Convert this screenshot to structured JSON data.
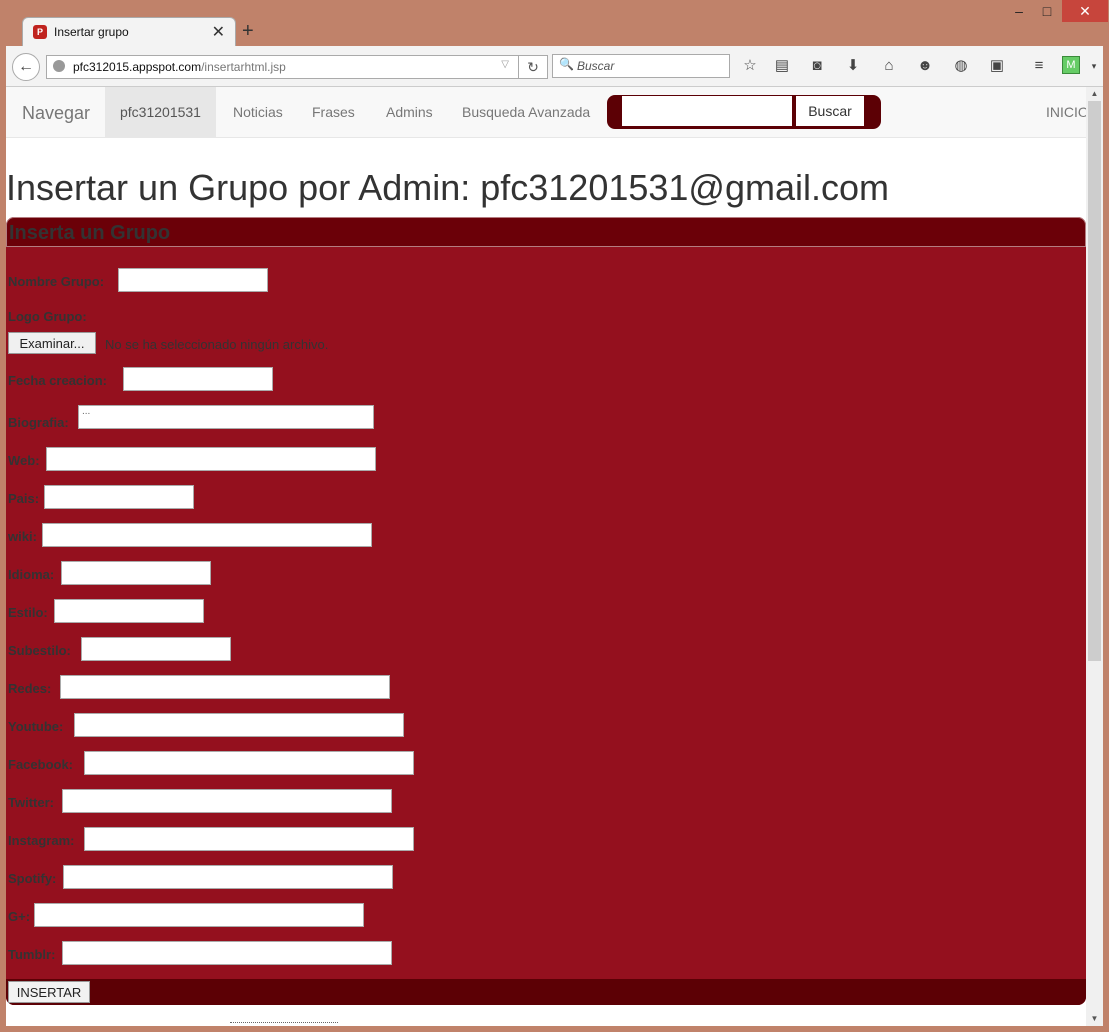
{
  "browser": {
    "tab_title": "Insertar grupo",
    "favicon_text": "P",
    "url_host": "pfc312015.appspot.com",
    "url_path": "/insertarhtml.jsp",
    "search_placeholder": "Buscar"
  },
  "navbar": {
    "brand": "Navegar",
    "items": [
      "pfc31201531",
      "Noticias",
      "Frases",
      "Admins",
      "Busqueda Avanzada"
    ],
    "search_button": "Buscar",
    "right_link": "INICIO"
  },
  "page": {
    "title": "Insertar un Grupo por Admin: pfc31201531@gmail.com",
    "panel_title": "Inserta un Grupo",
    "logo_label": "Logo Grupo:",
    "file_button": "Examinar...",
    "file_status": "No se ha seleccionado ningún archivo.",
    "textarea_placeholder": "...",
    "submit": "INSERTAR",
    "fields": [
      {
        "label": "Nombre Grupo:"
      },
      {
        "label": "Fecha creacion:"
      },
      {
        "label": "Biografia:"
      },
      {
        "label": "Web:"
      },
      {
        "label": "Pais:"
      },
      {
        "label": "wiki:"
      },
      {
        "label": "Idioma:"
      },
      {
        "label": "Estilo:"
      },
      {
        "label": "Subestilo:"
      },
      {
        "label": "Redes:"
      },
      {
        "label": "Youtube:"
      },
      {
        "label": "Facebook:"
      },
      {
        "label": "Twitter:"
      },
      {
        "label": "Instagram:"
      },
      {
        "label": "Spotify:"
      },
      {
        "label": "G+:"
      },
      {
        "label": "Tumblr:"
      }
    ]
  },
  "colors": {
    "panel": "#94101e",
    "panel_header": "#6b0008",
    "search_frame": "#5c0005"
  }
}
